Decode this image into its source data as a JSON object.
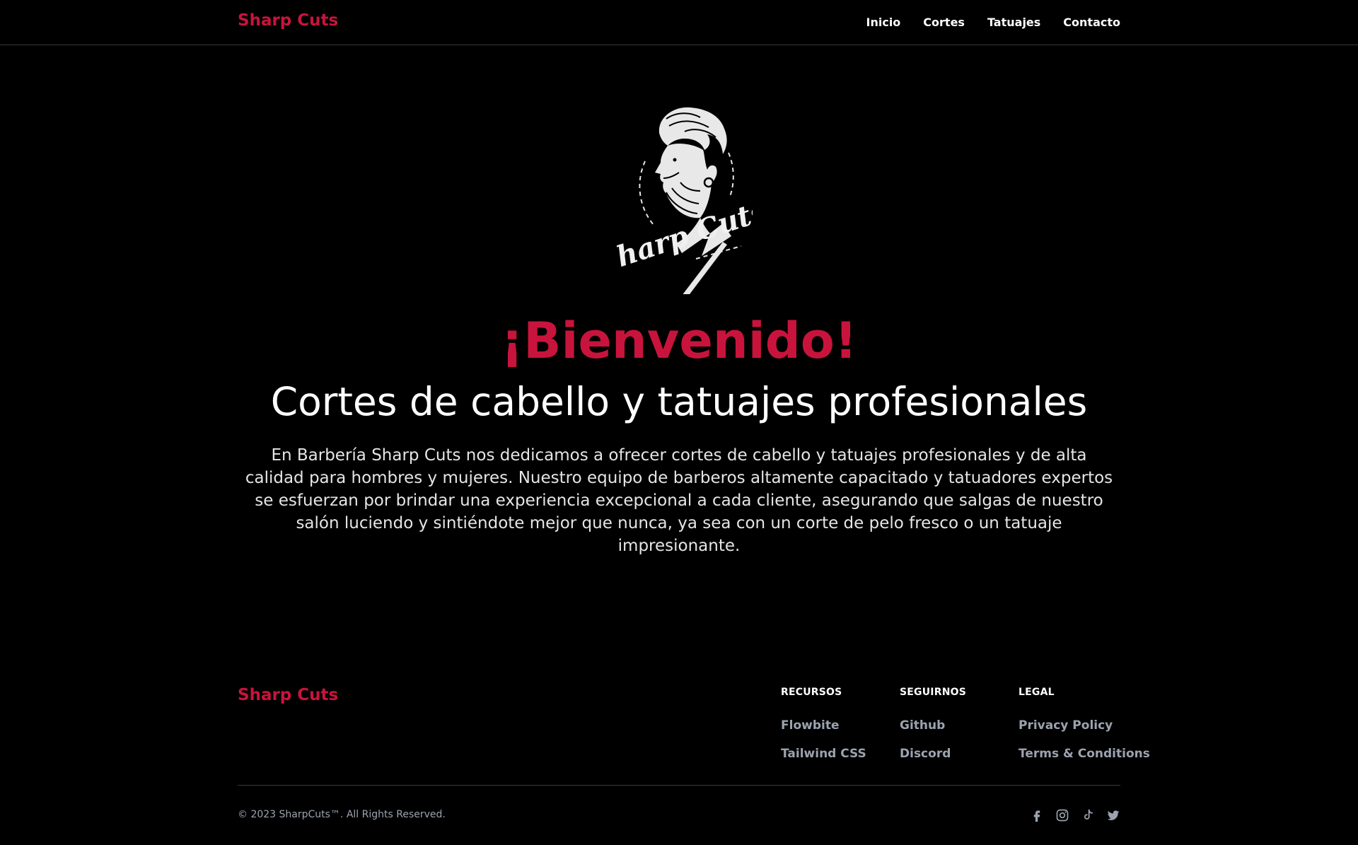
{
  "nav": {
    "brand": "Sharp Cuts",
    "links": [
      "Inicio",
      "Cortes",
      "Tatuajes",
      "Contacto"
    ]
  },
  "hero": {
    "logo_text": "Sharp Cuts",
    "title": "¡Bienvenido!",
    "subtitle": "Cortes de cabello y tatuajes profesionales",
    "description": "En Barbería Sharp Cuts nos dedicamos a ofrecer cortes de cabello y tatuajes profesionales y de alta calidad para hombres y mujeres. Nuestro equipo de barberos altamente capacitado y tatuadores expertos se esfuerzan por brindar una experiencia excepcional a cada cliente, asegurando que salgas de nuestro salón luciendo y sintiéndote mejor que nunca, ya sea con un corte de pelo fresco o un tatuaje impresionante."
  },
  "footer": {
    "brand": "Sharp Cuts",
    "columns": [
      {
        "heading": "RECURSOS",
        "links": [
          "Flowbite",
          "Tailwind CSS"
        ]
      },
      {
        "heading": "SEGUIRNOS",
        "links": [
          "Github",
          "Discord"
        ]
      },
      {
        "heading": "LEGAL",
        "links": [
          "Privacy Policy",
          "Terms & Conditions"
        ]
      }
    ],
    "copyright": "© 2023 SharpCuts™. All Rights Reserved.",
    "social_icons": [
      "facebook-icon",
      "instagram-icon",
      "tiktok-icon",
      "twitter-icon"
    ]
  },
  "colors": {
    "accent": "#c8143c",
    "background": "#000000",
    "muted_text": "#9ca3af"
  }
}
